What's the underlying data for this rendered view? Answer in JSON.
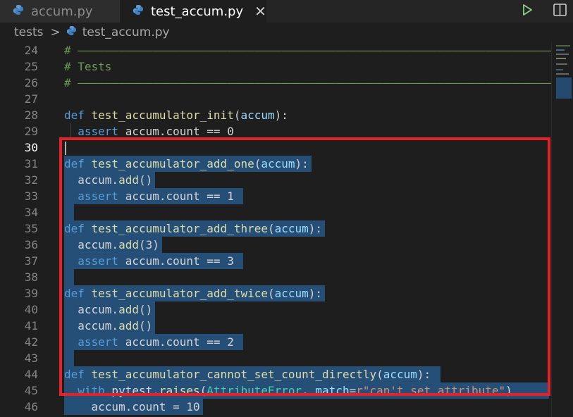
{
  "tabs": [
    {
      "label": "accum.py",
      "active": false
    },
    {
      "label": "test_accum.py",
      "active": true
    }
  ],
  "tab_close_glyph": "✕",
  "breadcrumb": {
    "folder": "tests",
    "separator": ">",
    "file": "test_accum.py"
  },
  "colors": {
    "selection": "#264f78",
    "keyword": "#569cd6",
    "function": "#dcdcaa",
    "variable": "#9cdcfe",
    "comment": "#6a9955",
    "string": "#ce9178",
    "class": "#4ec9b0",
    "annotation_box": "#e3222a"
  },
  "lines": [
    {
      "n": "24",
      "tokens": [
        {
          "t": "# ——————————————————————————————————————————————————————————————————————————————————————",
          "c": "cmt"
        }
      ]
    },
    {
      "n": "25",
      "tokens": [
        {
          "t": "# Tests",
          "c": "cmt"
        }
      ]
    },
    {
      "n": "26",
      "tokens": [
        {
          "t": "# ——————————————————————————————————————————————————————————————————————————————————————",
          "c": "cmt"
        }
      ]
    },
    {
      "n": "27",
      "tokens": []
    },
    {
      "n": "28",
      "tokens": [
        {
          "t": "def ",
          "c": "kw"
        },
        {
          "t": "test_accumulator_init",
          "c": "fn"
        },
        {
          "t": "(",
          "c": "p"
        },
        {
          "t": "accum",
          "c": "param"
        },
        {
          "t": "):",
          "c": "p"
        }
      ]
    },
    {
      "n": "29",
      "tokens": [
        {
          "t": "  ",
          "c": "p"
        },
        {
          "t": "assert",
          "c": "kw"
        },
        {
          "t": " accum.count == 0",
          "c": "p"
        }
      ]
    },
    {
      "n": "30",
      "tokens": [],
      "current": true
    },
    {
      "n": "31",
      "tokens": [
        {
          "t": "def ",
          "c": "kw"
        },
        {
          "t": "test_accumulator_add_one",
          "c": "fn"
        },
        {
          "t": "(",
          "c": "p"
        },
        {
          "t": "accum",
          "c": "param"
        },
        {
          "t": "):",
          "c": "p"
        }
      ],
      "sel_chars": 36
    },
    {
      "n": "32",
      "tokens": [
        {
          "t": "  accum.",
          "c": "p"
        },
        {
          "t": "add",
          "c": "fn"
        },
        {
          "t": "()",
          "c": "p"
        }
      ],
      "sel_chars": 13
    },
    {
      "n": "33",
      "tokens": [
        {
          "t": "  ",
          "c": "p"
        },
        {
          "t": "assert",
          "c": "kw"
        },
        {
          "t": " accum.count == 1",
          "c": "p"
        }
      ],
      "sel_chars": 26
    },
    {
      "n": "34",
      "tokens": [],
      "sel_chars": 1
    },
    {
      "n": "35",
      "tokens": [
        {
          "t": "def ",
          "c": "kw"
        },
        {
          "t": "test_accumulator_add_three",
          "c": "fn"
        },
        {
          "t": "(",
          "c": "p"
        },
        {
          "t": "accum",
          "c": "param"
        },
        {
          "t": "):",
          "c": "p"
        }
      ],
      "sel_chars": 38
    },
    {
      "n": "36",
      "tokens": [
        {
          "t": "  accum.",
          "c": "p"
        },
        {
          "t": "add",
          "c": "fn"
        },
        {
          "t": "(3)",
          "c": "p"
        }
      ],
      "sel_chars": 14
    },
    {
      "n": "37",
      "tokens": [
        {
          "t": "  ",
          "c": "p"
        },
        {
          "t": "assert",
          "c": "kw"
        },
        {
          "t": " accum.count == 3",
          "c": "p"
        }
      ],
      "sel_chars": 26
    },
    {
      "n": "38",
      "tokens": [],
      "sel_chars": 1
    },
    {
      "n": "39",
      "tokens": [
        {
          "t": "def ",
          "c": "kw"
        },
        {
          "t": "test_accumulator_add_twice",
          "c": "fn"
        },
        {
          "t": "(",
          "c": "p"
        },
        {
          "t": "accum",
          "c": "param"
        },
        {
          "t": "):",
          "c": "p"
        }
      ],
      "sel_chars": 38
    },
    {
      "n": "40",
      "tokens": [
        {
          "t": "  accum.",
          "c": "p"
        },
        {
          "t": "add",
          "c": "fn"
        },
        {
          "t": "()",
          "c": "p"
        }
      ],
      "sel_chars": 13
    },
    {
      "n": "41",
      "tokens": [
        {
          "t": "  accum.",
          "c": "p"
        },
        {
          "t": "add",
          "c": "fn"
        },
        {
          "t": "()",
          "c": "p"
        }
      ],
      "sel_chars": 13
    },
    {
      "n": "42",
      "tokens": [
        {
          "t": "  ",
          "c": "p"
        },
        {
          "t": "assert",
          "c": "kw"
        },
        {
          "t": " accum.count == 2",
          "c": "p"
        }
      ],
      "sel_chars": 26
    },
    {
      "n": "43",
      "tokens": [],
      "sel_chars": 1
    },
    {
      "n": "44",
      "tokens": [
        {
          "t": "def ",
          "c": "kw"
        },
        {
          "t": "test_accumulator_cannot_set_count_directly",
          "c": "fn"
        },
        {
          "t": "(",
          "c": "p"
        },
        {
          "t": "accum",
          "c": "param"
        },
        {
          "t": "):",
          "c": "p"
        }
      ],
      "sel_chars": 55
    },
    {
      "n": "45",
      "tokens": [
        {
          "t": "  ",
          "c": "p"
        },
        {
          "t": "with",
          "c": "kw"
        },
        {
          "t": " pytest.",
          "c": "p"
        },
        {
          "t": "raises",
          "c": "fn"
        },
        {
          "t": "(",
          "c": "p"
        },
        {
          "t": "AttributeError",
          "c": "cls"
        },
        {
          "t": ", ",
          "c": "p"
        },
        {
          "t": "match",
          "c": "param"
        },
        {
          "t": "=",
          "c": "p"
        },
        {
          "t": "r\"can't set attribute\"",
          "c": "str"
        },
        {
          "t": ")",
          "c": "p"
        }
      ],
      "sel_chars": 71
    },
    {
      "n": "46",
      "tokens": [
        {
          "t": "    accum.count = 10",
          "c": "p"
        }
      ],
      "sel_chars": 20
    }
  ]
}
